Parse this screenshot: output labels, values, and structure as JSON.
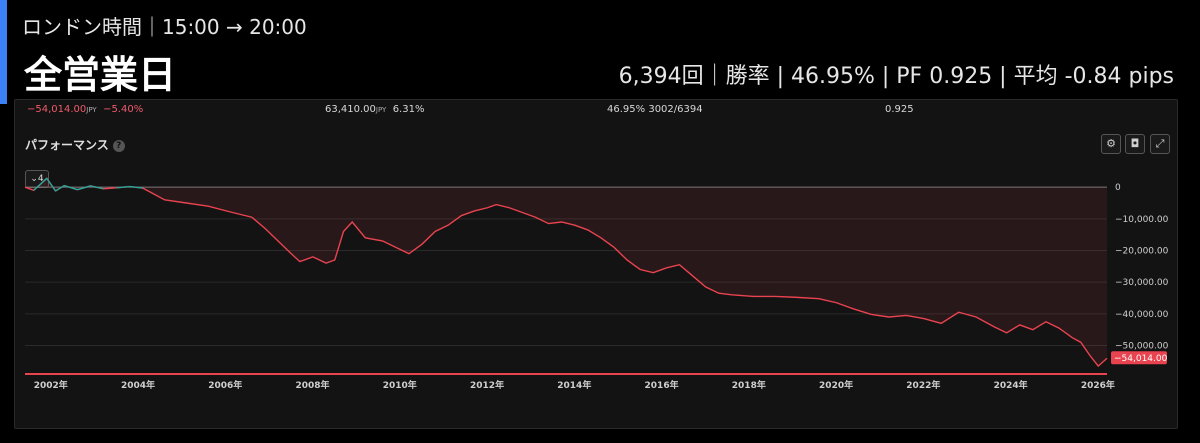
{
  "header": {
    "subtitle": "ロンドン時間｜15:00 → 20:00",
    "title": "全営業日",
    "stats": "6,394回｜勝率 | 46.95% | PF 0.925 | 平均 -0.84 pips"
  },
  "summary": {
    "net_profit": "−54,014.00",
    "net_unit": "JPY",
    "net_pct": "−5.40%",
    "gross": "63,410.00",
    "gross_unit": "JPY",
    "gross_pct": "6.31%",
    "win_rate": "46.95%",
    "win_count": "3002/6394",
    "profit_factor": "0.925"
  },
  "panel": {
    "label": "パフォーマンス",
    "help_icon": "?",
    "scale_button": "4",
    "icons": [
      "settings-icon",
      "camera-icon",
      "expand-icon"
    ]
  },
  "colors": {
    "line_negative": "#e8434f",
    "line_positive": "#26a69a",
    "accent": "#3b82f6",
    "last_value_badge": "#e8434f"
  },
  "chart_data": {
    "type": "line",
    "title": "",
    "xlabel": "",
    "ylabel": "",
    "x_ticks": [
      "2002年",
      "2004年",
      "2006年",
      "2008年",
      "2010年",
      "2012年",
      "2014年",
      "2016年",
      "2018年",
      "2020年",
      "2022年",
      "2024年",
      "2026年"
    ],
    "y_ticks": [
      "0",
      "−10,000.00",
      "−20,000.00",
      "−30,000.00",
      "−40,000.00",
      "−50,000.00"
    ],
    "xlim": [
      2001.8,
      2026.6
    ],
    "ylim": [
      -59000,
      1000
    ],
    "last_value_label": "−54,014.00",
    "grid": true,
    "series": [
      {
        "x": [
          2001.8,
          2002.0,
          2002.3,
          2002.5,
          2002.7,
          2003.0,
          2003.3,
          2003.6,
          2003.9,
          2004.2,
          2004.5,
          2004.8,
          2005.0,
          2005.5,
          2006.0,
          2006.5,
          2007.0,
          2007.3,
          2007.6,
          2007.9,
          2008.1,
          2008.4,
          2008.7,
          2008.9,
          2009.1,
          2009.3,
          2009.6,
          2010.0,
          2010.3,
          2010.6,
          2010.9,
          2011.2,
          2011.5,
          2011.8,
          2012.1,
          2012.4,
          2012.6,
          2012.9,
          2013.2,
          2013.5,
          2013.8,
          2014.1,
          2014.4,
          2014.7,
          2015.0,
          2015.3,
          2015.6,
          2015.9,
          2016.2,
          2016.5,
          2016.8,
          2017.1,
          2017.4,
          2017.7,
          2018.0,
          2018.5,
          2019.0,
          2019.5,
          2020.0,
          2020.4,
          2020.8,
          2021.2,
          2021.6,
          2022.0,
          2022.4,
          2022.8,
          2023.2,
          2023.6,
          2024.0,
          2024.3,
          2024.6,
          2024.9,
          2025.2,
          2025.5,
          2025.8,
          2026.0,
          2026.2,
          2026.4,
          2026.6
        ],
        "y": [
          0,
          -1000,
          2800,
          -1200,
          500,
          -800,
          400,
          -500,
          -200,
          200,
          -300,
          -2500,
          -4000,
          -5000,
          -6000,
          -7800,
          -9500,
          -13000,
          -17000,
          -21000,
          -23500,
          -22000,
          -24000,
          -23000,
          -14000,
          -11000,
          -16000,
          -17000,
          -19000,
          -21000,
          -18000,
          -14000,
          -12000,
          -9000,
          -7500,
          -6500,
          -5500,
          -6500,
          -8000,
          -9500,
          -11500,
          -11000,
          -12000,
          -13500,
          -16000,
          -19000,
          -23000,
          -26000,
          -27000,
          -25500,
          -24500,
          -28000,
          -31500,
          -33500,
          -34000,
          -34500,
          -34500,
          -34800,
          -35200,
          -36500,
          -38500,
          -40200,
          -41000,
          -40500,
          -41500,
          -43000,
          -39500,
          -41000,
          -44000,
          -46000,
          -43500,
          -45000,
          -42500,
          -44500,
          -47500,
          -49000,
          -53000,
          -56500,
          -54014
        ],
        "line_color": "#e8434f"
      }
    ]
  }
}
